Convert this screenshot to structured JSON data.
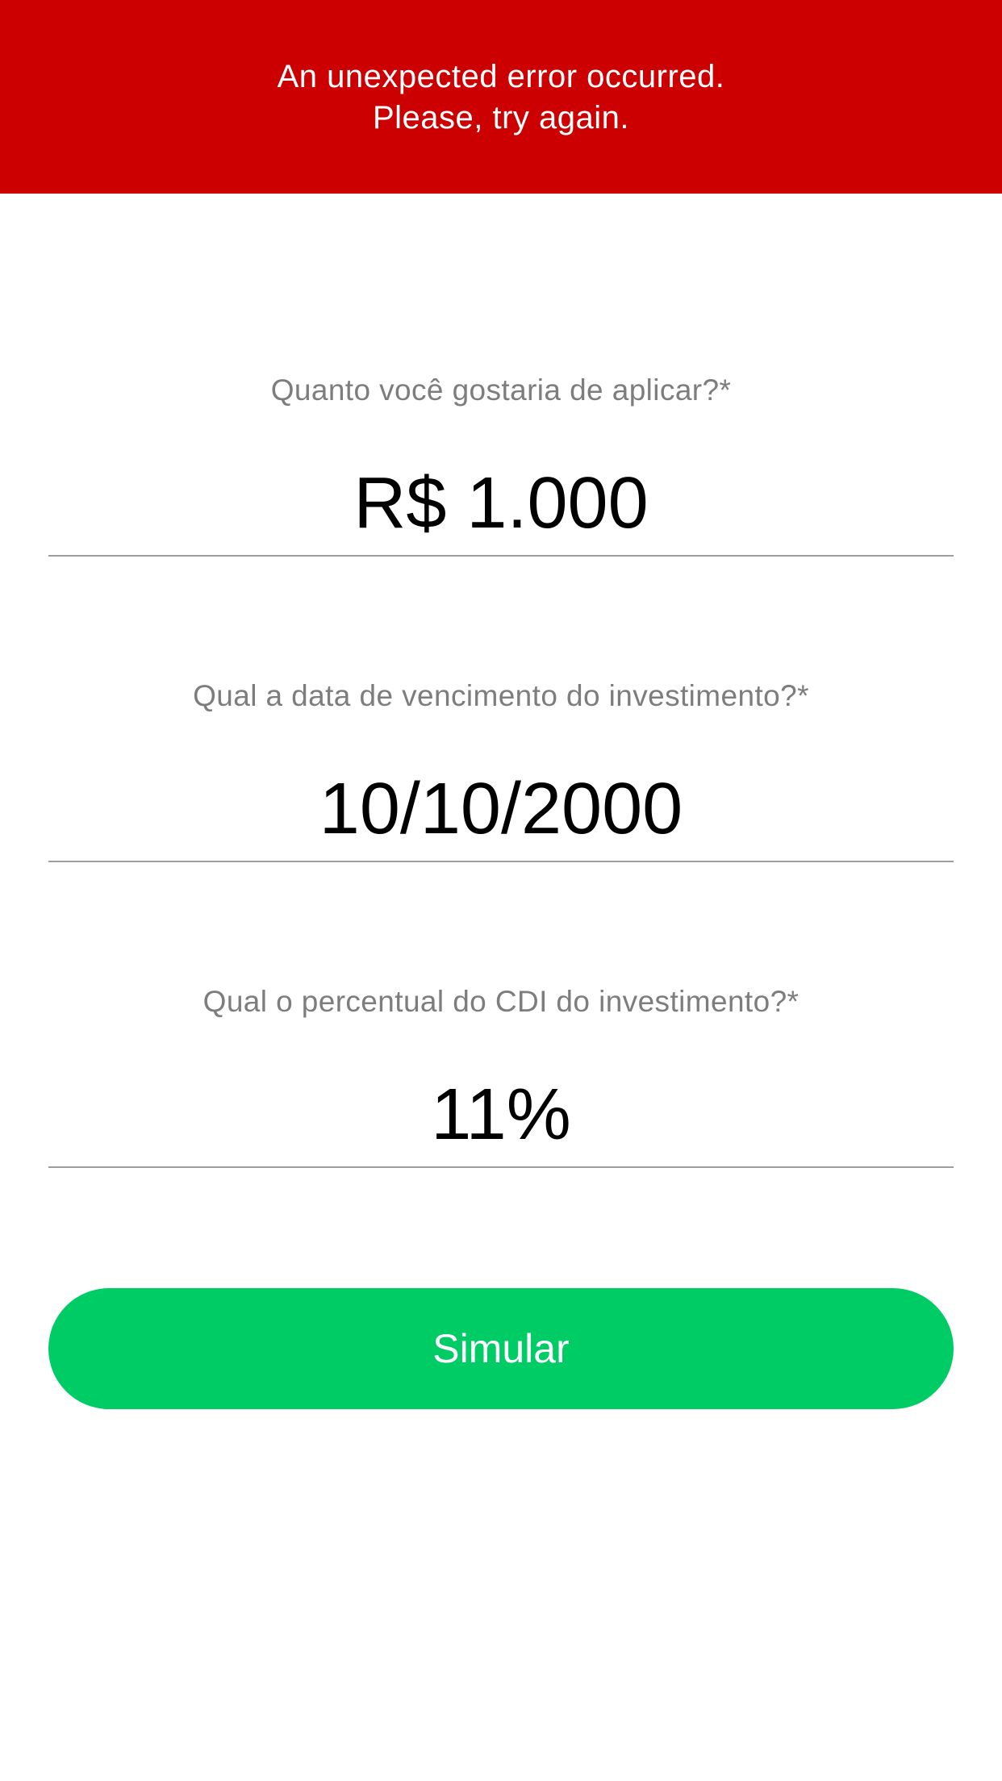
{
  "error_banner": {
    "line1": "An unexpected error occurred.",
    "line2": "Please, try again.",
    "color": "#cc0000"
  },
  "form": {
    "amount": {
      "label": "Quanto você gostaria de aplicar?*",
      "value": "R$ 1.000"
    },
    "maturity_date": {
      "label": "Qual a data de vencimento do investimento?*",
      "value": "10/10/2000"
    },
    "cdi_percent": {
      "label": "Qual o percentual do CDI do investimento?*",
      "value": "11%"
    }
  },
  "simulate_button": {
    "label": "Simular",
    "color": "#00cc66"
  }
}
